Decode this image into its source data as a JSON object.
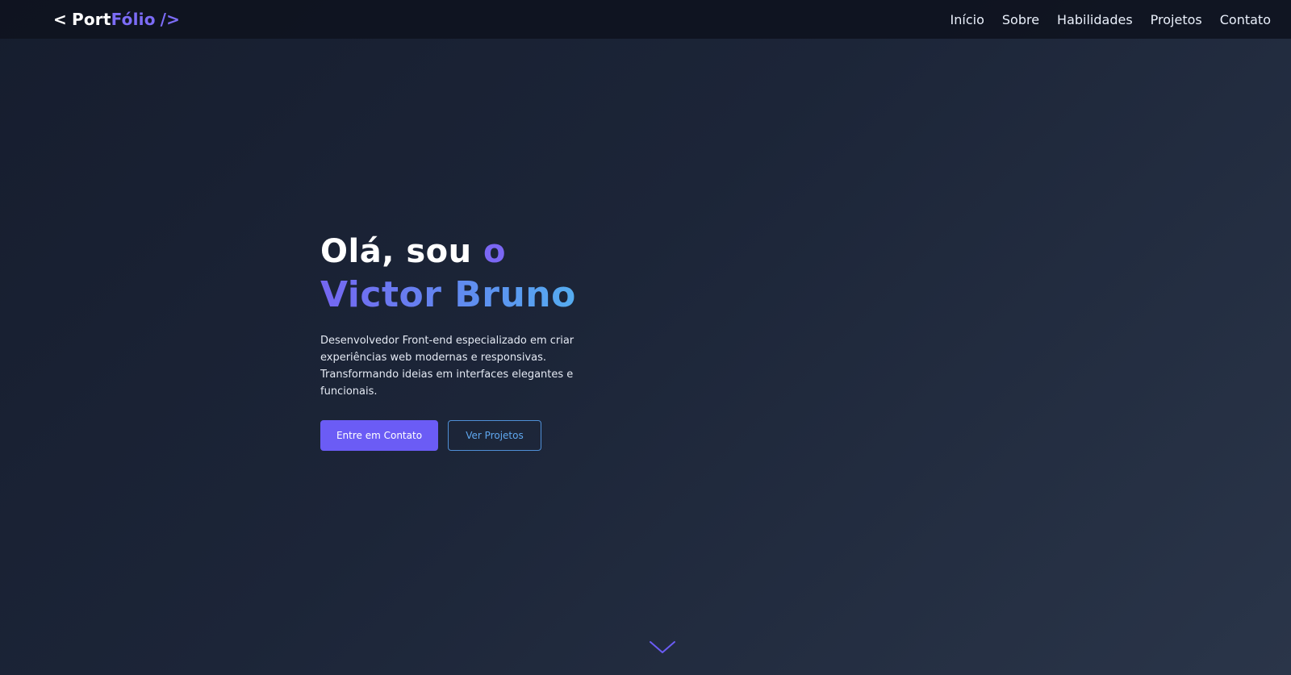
{
  "header": {
    "logo": {
      "bracket_open": "<",
      "part1": "Port",
      "part2": "Fólio",
      "bracket_close": "/>"
    },
    "nav": [
      {
        "label": "Início"
      },
      {
        "label": "Sobre"
      },
      {
        "label": "Habilidades"
      },
      {
        "label": "Projetos"
      },
      {
        "label": "Contato"
      }
    ]
  },
  "hero": {
    "greeting": "Olá, sou",
    "greeting_accent": "o",
    "name": "Victor Bruno",
    "description": "Desenvolvedor Front-end especializado em criar experiências web modernas e responsivas. Transformando ideias em interfaces elegantes e funcionais.",
    "primary_button": "Entre em Contato",
    "secondary_button": "Ver Projetos"
  },
  "icons": {
    "scroll": "chevron-down-icon"
  },
  "colors": {
    "accent_purple": "#6b5cf5",
    "accent_blue": "#5fa8f0",
    "background": "#1c2538",
    "header": "#0e131f"
  }
}
